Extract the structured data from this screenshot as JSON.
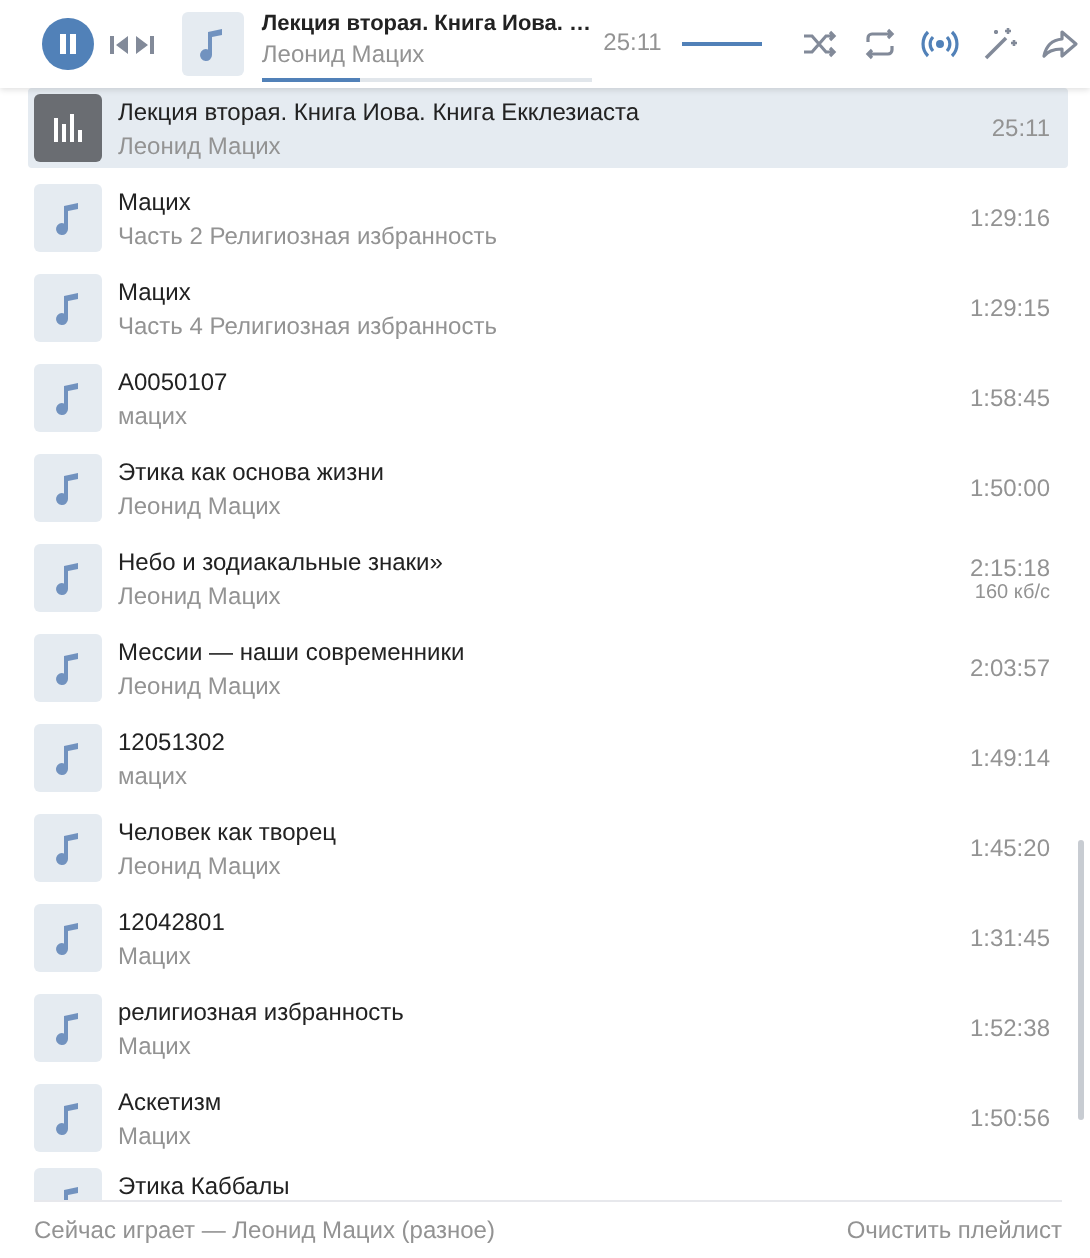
{
  "player": {
    "playing": true,
    "title": "Лекция вторая. Книга Иова. …",
    "artist": "Леонид Мацих",
    "time": "25:11",
    "progress": {
      "level": 0.3
    },
    "volume": {
      "level": 1
    },
    "controls": [
      {
        "kind": "shuffle",
        "on": false
      },
      {
        "kind": "repeat",
        "on": false
      },
      {
        "kind": "broadcast",
        "on": true
      },
      {
        "kind": "recommend",
        "on": false
      },
      {
        "kind": "share",
        "on": false
      }
    ]
  },
  "tracks": [
    {
      "title": "Лекция вторая. Книга Иова. Книга Екклезиаста",
      "artist": "Леонид Мацих",
      "duration": "25:11",
      "selected": true
    },
    {
      "title": "Мацих",
      "artist": "Часть 2 Религиозная избранность",
      "duration": "1:29:16",
      "selected": false
    },
    {
      "title": "Мацих",
      "artist": "Часть 4 Религиозная избранность",
      "duration": "1:29:15",
      "selected": false
    },
    {
      "title": "A0050107",
      "artist": "мацих",
      "duration": "1:58:45",
      "selected": false
    },
    {
      "title": "Этика как основа жизни",
      "artist": "Леонид Мацих",
      "duration": "1:50:00",
      "selected": false
    },
    {
      "title": "Небо и зодиакальные знаки»",
      "artist": "Леонид Мацих",
      "duration": "2:15:18",
      "bitrate": "160 кб/с",
      "selected": false
    },
    {
      "title": "Мессии — наши современники",
      "artist": "Леонид Мацих",
      "duration": "2:03:57",
      "selected": false
    },
    {
      "title": "12051302",
      "artist": "мацих",
      "duration": "1:49:14",
      "selected": false
    },
    {
      "title": "Человек как творец",
      "artist": "Леонид Мацих",
      "duration": "1:45:20",
      "selected": false
    },
    {
      "title": "12042801",
      "artist": "Мацих",
      "duration": "1:31:45",
      "selected": false
    },
    {
      "title": "религиозная избранность",
      "artist": "Мацих",
      "duration": "1:52:38",
      "selected": false
    },
    {
      "title": "Аскетизм",
      "artist": "Мацих",
      "duration": "1:50:56",
      "selected": false
    },
    {
      "title": "Этика Каббалы",
      "selected": false
    }
  ],
  "footer": {
    "now_playing": "Сейчас играет — Леонид Мацих (разное)",
    "clear": "Очистить плейлист"
  }
}
